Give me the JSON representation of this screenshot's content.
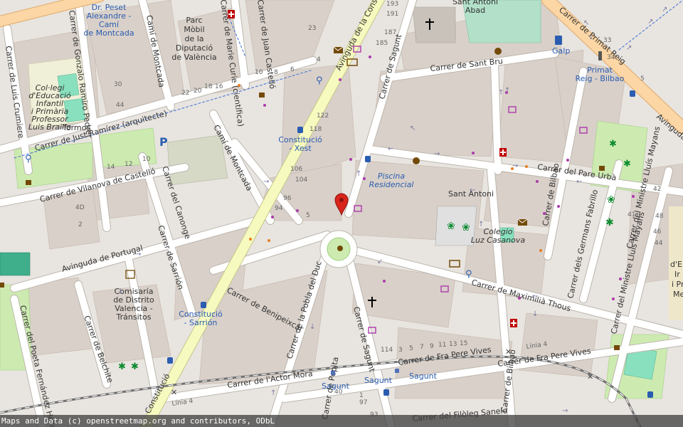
{
  "attribution": "Maps and Data (c) openstreetmap.org and contributors, ODbL",
  "marker": {
    "name": "location-marker",
    "color": "#d9241c"
  },
  "streets": {
    "avinguda_constitucio": "Avinguda de la Constitució",
    "carrer_sagunt": "Carrer de Sagunt",
    "carrer_sant_bru": "Carrer de Sant Bru",
    "carrer_just_ramirez": "Carrer de Just Ramírez (arquitecte)",
    "cami_montcada_top": "Camí de Montcada",
    "cami_montcada_mid": "Camí de Montcada",
    "carrer_gonzalo": "Carrer de Gonzalo Ramiro Pedrer",
    "carrer_luis_crumiere": "Carrer de Luis Crumiere",
    "carrer_marie_curie": "Carrer de Marie Curie (científica)",
    "carrer_juan_castello": "Carrer de Juan Castelló",
    "carrer_vilanova": "Carrer de Vilanova de Castelló",
    "carrer_canonge": "Carrer del Canonge",
    "avinguda_portugal": "Avinguda de Portugal",
    "carrer_sarrion": "Carrer de Sarrión",
    "carrer_benipeixcar": "Carrer de Benipeixcar",
    "carrer_pobla_duc": "Carrer de la Pobla del Duc",
    "carrer_sagunt_south": "Carrer de Sagunt",
    "carrer_maximilia": "Carrer de Maximilià Thous",
    "carrer_pare_urba": "Carrer del Pare Urbà",
    "carrer_bilbao": "Carrer de Bilbao",
    "carrer_germans": "Carrer dels Germans Fabrillo",
    "carrer_ministre_top": "Carrer del Ministre Lluís Mayans",
    "carrer_ministre_bottom": "Carrer del Ministre Lluís Mayans",
    "avinguda_primat": "Avinguda",
    "carrer_primat_reig": "Carrer de Primat Reig",
    "carrer_fra_pere_1": "Carrer de Fra Pere Vives",
    "carrer_fra_pere_2": "Carrer de Fra Pere Vives",
    "carrer_actor_mora": "Carrer de l'Actor Mora",
    "carrer_poeta": "Carrer del Poeta Fernández Heras",
    "carrer_belchite": "Carrer de Belchite",
    "carrer_bilbao_south": "Carrer de Bilbao",
    "carrer_filoleg": "Carrer del Filòleg Sanelo",
    "carrer_pepita": "Carrer de Pepita",
    "linia4_a": "Línia 4",
    "linia4_b": "Línia 4",
    "constitucio_south": "Constitució"
  },
  "places": {
    "dr_peset": [
      "Dr. Peset",
      "Alexandre -",
      "Camí",
      "de Montcada"
    ],
    "parc_mobil": [
      "Parc",
      "Mòbil",
      "de la",
      "Diputació",
      "de València"
    ],
    "collegi": [
      "Col·legi",
      "d'Educació",
      "Infantil",
      "i Primària",
      "Professor",
      "Luis Braille"
    ],
    "tormos": "Tormos",
    "constitucio_xest": [
      "Constitució",
      "- Xest"
    ],
    "piscina": [
      "Piscina",
      "Residencial"
    ],
    "sant_antoni_district": "Sant Antoni",
    "colegio_luz": [
      "Colegio",
      "Luz Casanova"
    ],
    "comisaria": [
      "Comisaría",
      "de Distrito",
      "Valencia -",
      "Tránsitos"
    ],
    "constitucio_sarrion": [
      "Constitució",
      "- Sarrión"
    ],
    "primat_reig_bilbao": [
      "Primat",
      "Reig - Bilbao"
    ],
    "galp": "Galp",
    "sant_antoni_abad": [
      "Sant Antoni",
      "Abad"
    ],
    "sagunt_1": "Sagunt",
    "sagunt_2": "Sagunt",
    "sagunt_3": "Sagunt",
    "edge_right": [
      "d'E",
      "Ir",
      "i Pr",
      "Me"
    ]
  },
  "house_numbers": {
    "n193": "193",
    "n191": "191",
    "n187": "187",
    "n185": "185",
    "n23": "23",
    "n10a": "10",
    "n8a": "8",
    "n6a": "6",
    "n4a": "4",
    "n22": "22",
    "n20": "20",
    "n18": "18",
    "n16": "16",
    "n30": "30",
    "n44": "44",
    "n122": "122",
    "n118": "118",
    "n106": "106",
    "n104": "104",
    "n96": "96",
    "n94": "94",
    "n5": "5",
    "n14": "14",
    "n12": "12",
    "n10b": "10",
    "n4d": "4D",
    "n2": "2",
    "n114": "114",
    "n3": "3",
    "n5b": "5",
    "n7": "7",
    "n9": "9",
    "n11": "11",
    "n13": "13",
    "n15": "15",
    "n40": "40",
    "n1": "1",
    "n97": "97",
    "n93": "93",
    "n6": "6",
    "n33": "33",
    "n34": "34",
    "n5c": "5",
    "n48": "48",
    "n46": "46",
    "n44b": "44",
    "n41": "41",
    "n42": "42"
  },
  "colors": {
    "background": "#f2efe9",
    "building": "#d9d0c9",
    "primary_road": "#f7fabf",
    "primary_border": "#c4c58a",
    "trunk_road": "#fcd6a4",
    "green": "#c8facc",
    "park": "#cdebb0",
    "pitch": "#88e0be",
    "residential": "#e0dfdf",
    "poi_blue": "#2a5db0",
    "amenity_brown": "#734a08",
    "shop_purple": "#ac39ac",
    "health_red": "#bf0000"
  }
}
